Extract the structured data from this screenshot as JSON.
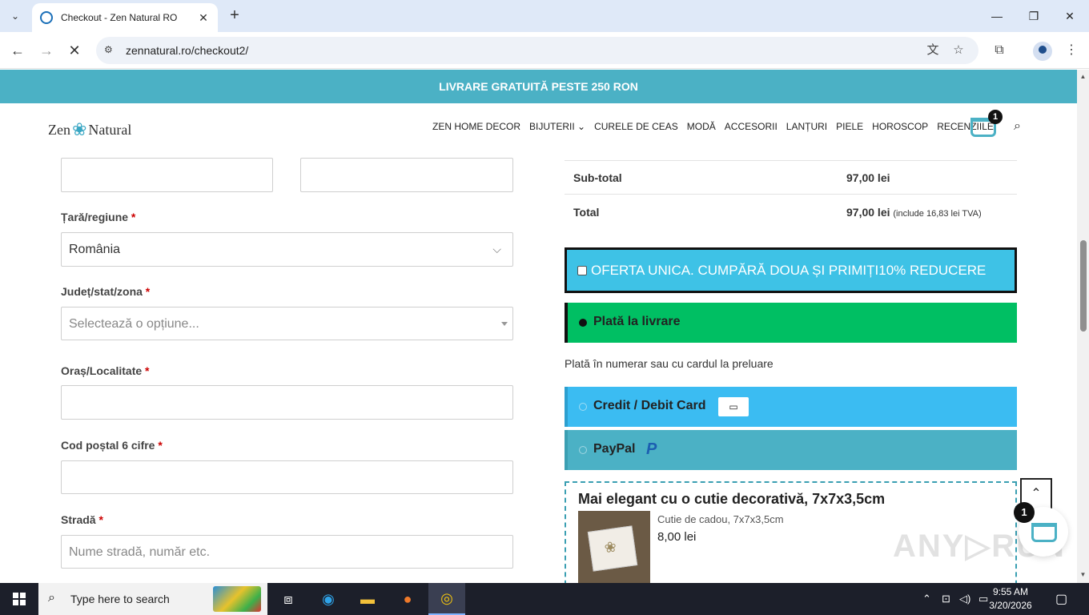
{
  "browser": {
    "tab_title": "Checkout - Zen Natural RO",
    "url": "zennatural.ro/checkout2/"
  },
  "site": {
    "promo": "LIVRARE GRATUITĂ PESTE 250 RON",
    "logo_left": "Zen",
    "logo_right": "Natural",
    "menu": [
      "ZEN HOME DECOR",
      "BIJUTERII ⌄",
      "CURELE DE CEAS",
      "MODĂ",
      "ACCESORII",
      "LANȚURI",
      "PIELE",
      "HOROSCOP",
      "RECENZIILE"
    ],
    "cart_count": "1"
  },
  "form": {
    "country_label": "Țară/regiune",
    "country_value": "România",
    "county_label": "Județ/stat/zona",
    "county_placeholder": "Selectează o opțiune...",
    "city_label": "Oraș/Localitate",
    "zip_label": "Cod poștal 6 cifre",
    "street_label": "Stradă",
    "street_placeholder": "Nume stradă, număr etc.",
    "required_mark": "*"
  },
  "summary": {
    "subtotal_label": "Sub-total",
    "subtotal_value": "97,00 lei",
    "total_label": "Total",
    "total_value": "97,00 lei",
    "total_note": "(include 16,83 lei TVA)"
  },
  "offer": {
    "text": "OFERTA UNICA. CUMPĂRĂ DOUA ȘI PRIMIȚI10% REDUCERE"
  },
  "payment": {
    "cod_label": "Plată la livrare",
    "cod_desc": "Plată în numerar sau cu cardul la preluare",
    "card_label": "Credit / Debit Card",
    "paypal_label": "PayPal",
    "paypal_logo": "P"
  },
  "upsell": {
    "title": "Mai elegant cu o cutie decorativă, 7x7x3,5cm",
    "product_name": "Cutie de cadou, 7x7x3,5cm",
    "price": "8,00 lei"
  },
  "floating_cart_count": "1",
  "watermark": "ANY▷RUN",
  "taskbar": {
    "search_text": "Type here to search",
    "time": "9:55 AM",
    "date": "3/20/2026"
  },
  "colors": {
    "promo_bar": "#4bb1c5",
    "offer_bg": "#3ec2e6",
    "cod_bg": "#00bf63",
    "card_bg": "#3bbcf2",
    "paypal_bg": "#4bb1c5"
  }
}
